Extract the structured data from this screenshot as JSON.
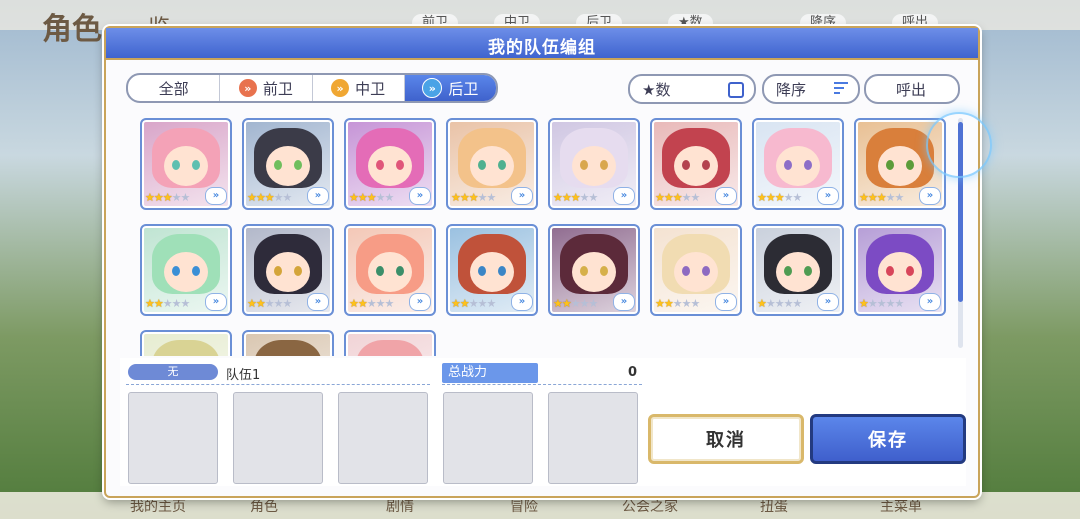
{
  "background": {
    "title": "角色",
    "title_extra": "览",
    "top_tabs": [
      "前卫",
      "中卫",
      "后卫",
      "★数",
      "降序",
      "呼出"
    ],
    "bottom_nav": [
      "我的主页",
      "角色",
      "剧情",
      "冒险",
      "公会之家",
      "扭蛋",
      "主菜单"
    ]
  },
  "dialog": {
    "title": "我的队伍编组",
    "filters": {
      "all": "全部",
      "front": "前卫",
      "mid": "中卫",
      "back": "后卫",
      "active": "后卫"
    },
    "sort": {
      "stars_label": "★数",
      "order_label": "降序",
      "call_label": "呼出"
    },
    "characters": [
      {
        "stars": 3,
        "hair": "#f4a2b7",
        "eye": "#5fbfb0",
        "bg": "#d8a4c8"
      },
      {
        "stars": 3,
        "hair": "#3b3b48",
        "eye": "#6fbe5e",
        "bg": "#a0b4cf"
      },
      {
        "stars": 3,
        "hair": "#e46cb7",
        "eye": "#e0567a",
        "bg": "#c593d6"
      },
      {
        "stars": 3,
        "hair": "#f3c28a",
        "eye": "#4fb08f",
        "bg": "#e9c2a6"
      },
      {
        "stars": 3,
        "hair": "#e6dcef",
        "eye": "#d9a74e",
        "bg": "#cfc6e2"
      },
      {
        "stars": 3,
        "hair": "#c2434f",
        "eye": "#b3434f",
        "bg": "#e8b8b8"
      },
      {
        "stars": 3,
        "hair": "#f7b9cf",
        "eye": "#8d6ec8",
        "bg": "#d8e4f2"
      },
      {
        "stars": 3,
        "hair": "#d97f3b",
        "eye": "#5c9c3a",
        "bg": "#e8bf92"
      },
      {
        "stars": 2,
        "hair": "#9fe0b8",
        "eye": "#3b8fd6",
        "bg": "#bfe4d2"
      },
      {
        "stars": 2,
        "hair": "#2e2b3a",
        "eye": "#d4a53a",
        "bg": "#b1b7c9"
      },
      {
        "stars": 2,
        "hair": "#f79c86",
        "eye": "#3c8f6a",
        "bg": "#f3c7b6"
      },
      {
        "stars": 2,
        "hair": "#c0523a",
        "eye": "#3b86c6",
        "bg": "#99c0e0"
      },
      {
        "stars": 2,
        "hair": "#5c2a3a",
        "eye": "#d6b04a",
        "bg": "#8f6b8f"
      },
      {
        "stars": 2,
        "hair": "#f1dcb2",
        "eye": "#8e6ac1",
        "bg": "#f4e2d1"
      },
      {
        "stars": 1,
        "hair": "#2c2c34",
        "eye": "#4f9c52",
        "bg": "#c9d0dc"
      },
      {
        "stars": 1,
        "hair": "#7c4bc4",
        "eye": "#d8455a",
        "bg": "#b59dd6"
      },
      {
        "stars": 0,
        "hair": "#d9d394",
        "eye": "#6a8a3a",
        "bg": "#e6ecd0"
      },
      {
        "stars": 0,
        "hair": "#8a6642",
        "eye": "#5a4a3a",
        "bg": "#d9c6b0"
      },
      {
        "stars": 0,
        "hair": "#f0a4a8",
        "eye": "#d05a6a",
        "bg": "#f1d3d6"
      }
    ],
    "party": {
      "tag": "无",
      "name": "队伍1",
      "power_label": "总战力",
      "power_value": "0"
    },
    "buttons": {
      "cancel": "取消",
      "save": "保存"
    }
  }
}
